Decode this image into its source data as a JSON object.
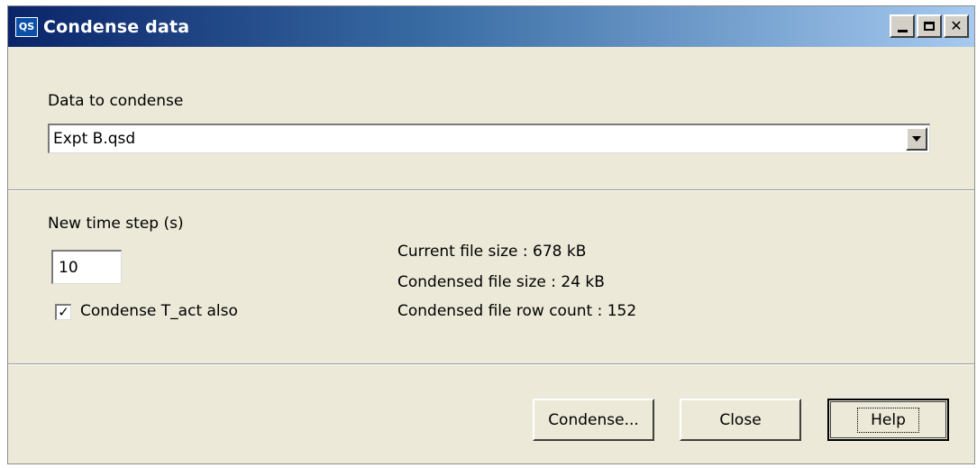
{
  "window": {
    "title": "Condense data",
    "icon_text": "QS",
    "controls": [
      "minimize",
      "maximize",
      "close"
    ]
  },
  "data_section": {
    "label": "Data to condense",
    "selected_file": "Expt B.qsd"
  },
  "time_section": {
    "time_step_label": "New time step (s)",
    "time_step_value": "10",
    "condense_tact_label": "Condense T_act also",
    "condense_tact_checked": true,
    "current_file_size": "Current file size : 678 kB",
    "condensed_file_size": "Condensed file size : 24 kB",
    "condensed_row_count": "Condensed file row count : 152"
  },
  "buttons": {
    "condense": "Condense...",
    "close": "Close",
    "help": "Help"
  }
}
